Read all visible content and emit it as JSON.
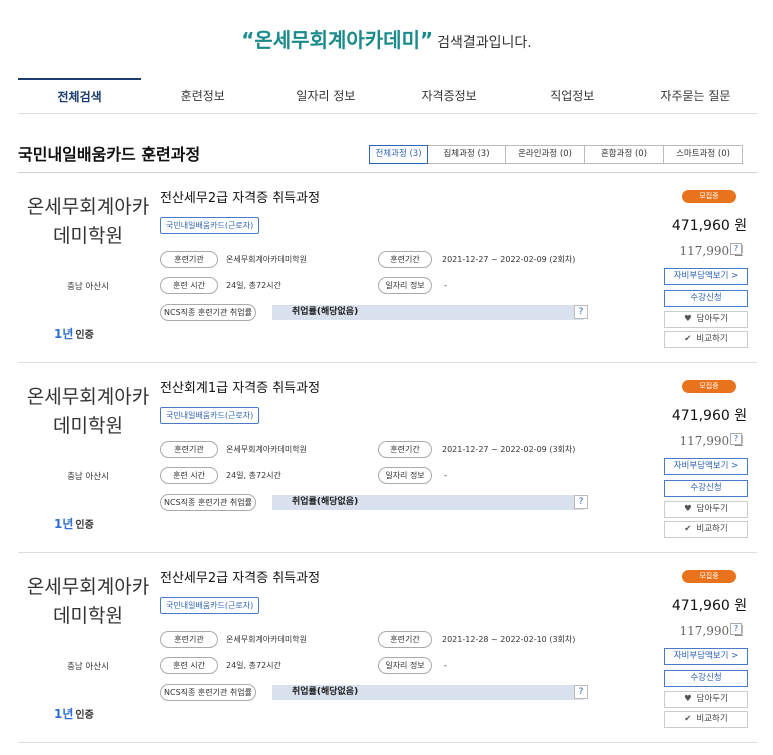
{
  "search": {
    "keyword": "“온세무회계아카데미”",
    "suffix": "검색결과입니다."
  },
  "tabs": [
    {
      "label": "전체검색",
      "active": true
    },
    {
      "label": "훈련정보",
      "active": false
    },
    {
      "label": "일자리 정보",
      "active": false
    },
    {
      "label": "자격증정보",
      "active": false
    },
    {
      "label": "직업정보",
      "active": false
    },
    {
      "label": "자주묻는 질문",
      "active": false
    }
  ],
  "section": {
    "title": "국민내일배움카드 훈련과정",
    "filters": [
      {
        "label": "전체과정 (3)",
        "active": true
      },
      {
        "label": "집체과정 (3)",
        "active": false
      },
      {
        "label": "온라인과정 (0)",
        "active": false
      },
      {
        "label": "혼합과정 (0)",
        "active": false
      },
      {
        "label": "스마트과정 (0)",
        "active": false
      }
    ]
  },
  "colors": {
    "keyword": "#1a8a8a",
    "accent": "#2f63b6",
    "badge": "#e8731c",
    "ncs_bar": "#d9e1ee"
  },
  "courses": [
    {
      "institution": "온세무회계아카데미학원",
      "region": "충남 아산시",
      "cert_icon": "1년",
      "cert_label": "인증",
      "title": "전산세무2급 자격증 취득과정",
      "tag": "국민내일배움카드(근로자)",
      "inst_label": "훈련기관",
      "inst_value": "온세무회계아카데미학원",
      "period_label": "훈련기간",
      "period_value": "2021-12-27 ~ 2022-02-09 (2회차)",
      "time_label": "훈련 시간",
      "time_value": "24일, 총72시간",
      "job_label": "일자리 정보",
      "job_value": "-",
      "ncs_label": "NCS직종 훈련기관 취업률",
      "ncs_value": "취업률(해당없음)",
      "help": "?",
      "status": "모집중",
      "price": "471,960 원",
      "self_pay": "117,990 원",
      "self_pay_help": "?",
      "btn_self_pay": "자비부담액보기 >",
      "btn_apply": "수강신청",
      "btn_wish": "담아두기",
      "btn_compare": "비교하기"
    },
    {
      "institution": "온세무회계아카데미학원",
      "region": "충남 아산시",
      "cert_icon": "1년",
      "cert_label": "인증",
      "title": "전산회계1급 자격증 취득과정",
      "tag": "국민내일배움카드(근로자)",
      "inst_label": "훈련기관",
      "inst_value": "온세무회계아카데미학원",
      "period_label": "훈련기간",
      "period_value": "2021-12-27 ~ 2022-02-09 (3회차)",
      "time_label": "훈련 시간",
      "time_value": "24일, 총72시간",
      "job_label": "일자리 정보",
      "job_value": "-",
      "ncs_label": "NCS직종 훈련기관 취업률",
      "ncs_value": "취업률(해당없음)",
      "help": "?",
      "status": "모집중",
      "price": "471,960 원",
      "self_pay": "117,990 원",
      "self_pay_help": "?",
      "btn_self_pay": "자비부담액보기 >",
      "btn_apply": "수강신청",
      "btn_wish": "담아두기",
      "btn_compare": "비교하기"
    },
    {
      "institution": "온세무회계아카데미학원",
      "region": "충남 아산시",
      "cert_icon": "1년",
      "cert_label": "인증",
      "title": "전산세무2급 자격증 취득과정",
      "tag": "국민내일배움카드(근로자)",
      "inst_label": "훈련기관",
      "inst_value": "온세무회계아카데미학원",
      "period_label": "훈련기간",
      "period_value": "2021-12-28 ~ 2022-02-10 (3회차)",
      "time_label": "훈련 시간",
      "time_value": "24일, 총72시간",
      "job_label": "일자리 정보",
      "job_value": "-",
      "ncs_label": "NCS직종 훈련기관 취업률",
      "ncs_value": "취업률(해당없음)",
      "help": "?",
      "status": "모집중",
      "price": "471,960 원",
      "self_pay": "117,990 원",
      "self_pay_help": "?",
      "btn_self_pay": "자비부담액보기 >",
      "btn_apply": "수강신청",
      "btn_wish": "담아두기",
      "btn_compare": "비교하기"
    }
  ]
}
